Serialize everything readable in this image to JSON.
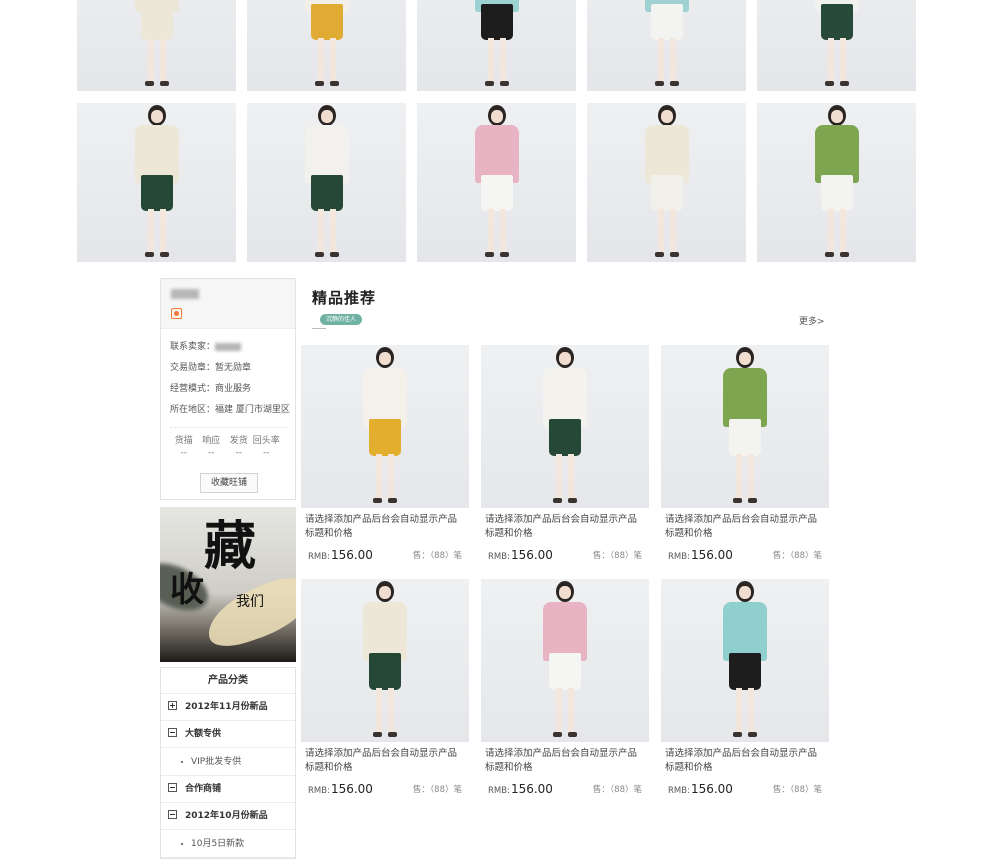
{
  "gallery": {
    "row1": [
      {
        "top": "#ece7d6",
        "bottom": "#ece7d6"
      },
      {
        "top": "#f2efe8",
        "bottom": "#e0ab33"
      },
      {
        "top": "#9cd3d2",
        "bottom": "#1d1d1d"
      },
      {
        "top": "#9fd1d3",
        "bottom": "#f3f3f1"
      },
      {
        "top": "#f1f1ef",
        "bottom": "#274a3a"
      }
    ],
    "row2": [
      {
        "top": "#ece7d6",
        "bottom": "#254735"
      },
      {
        "top": "#f2f1ed",
        "bottom": "#254735"
      },
      {
        "top": "#e8b3c2",
        "bottom": "#f5f5f3"
      },
      {
        "top": "#ece7d6",
        "bottom": "#f1f0ea"
      },
      {
        "top": "#7ea650",
        "bottom": "#f3f3f0"
      }
    ]
  },
  "shop": {
    "contact_label": "联系卖家：",
    "medal": "交易勋章：暂无勋章",
    "mode": "经营模式：商业服务",
    "location": "所在地区：福建 厦门市湖里区",
    "ratings": [
      {
        "label": "货描",
        "value": "--"
      },
      {
        "label": "响应",
        "value": "--"
      },
      {
        "label": "发货",
        "value": "--"
      },
      {
        "label": "回头率",
        "value": "--"
      }
    ],
    "fav_button": "收藏旺铺"
  },
  "banner": {
    "big1": "藏",
    "big2": "收",
    "small": "我们"
  },
  "categories": {
    "title": "产品分类",
    "items": [
      {
        "type": "group",
        "label": "2012年11月份新品",
        "expanded": false
      },
      {
        "type": "group",
        "label": "大额专供",
        "expanded": true
      },
      {
        "type": "sub",
        "label": "VIP批发专供"
      },
      {
        "type": "group",
        "label": "合作商铺",
        "expanded": true
      },
      {
        "type": "group",
        "label": "2012年10月份新品",
        "expanded": true
      },
      {
        "type": "sub",
        "label": "10月5日新款"
      }
    ]
  },
  "recommend": {
    "title": "精品推荐",
    "tag": "沉静的佳人",
    "more": "更多>",
    "products": [
      {
        "title": "请选择添加产品后台会自动显示产品标题和价格",
        "currency": "RMB:",
        "price": "156.00",
        "sold": "售：（88）笔",
        "top": "#f3f1ea",
        "bottom": "#e3ad2e"
      },
      {
        "title": "请选择添加产品后台会自动显示产品标题和价格",
        "currency": "RMB:",
        "price": "156.00",
        "sold": "售：（88）笔",
        "top": "#f3f2ed",
        "bottom": "#264836"
      },
      {
        "title": "请选择添加产品后台会自动显示产品标题和价格",
        "currency": "RMB:",
        "price": "156.00",
        "sold": "售：（88）笔",
        "top": "#7ea650",
        "bottom": "#f3f3f0"
      },
      {
        "title": "请选择添加产品后台会自动显示产品标题和价格",
        "currency": "RMB:",
        "price": "156.00",
        "sold": "售：（88）笔",
        "top": "#ece7d6",
        "bottom": "#254735"
      },
      {
        "title": "请选择添加产品后台会自动显示产品标题和价格",
        "currency": "RMB:",
        "price": "156.00",
        "sold": "售：（88）笔",
        "top": "#e8b3c2",
        "bottom": "#f5f5f3"
      },
      {
        "title": "请选择添加产品后台会自动显示产品标题和价格",
        "currency": "RMB:",
        "price": "156.00",
        "sold": "售：（88）笔",
        "top": "#8fd0cf",
        "bottom": "#1d1d1d"
      }
    ]
  }
}
